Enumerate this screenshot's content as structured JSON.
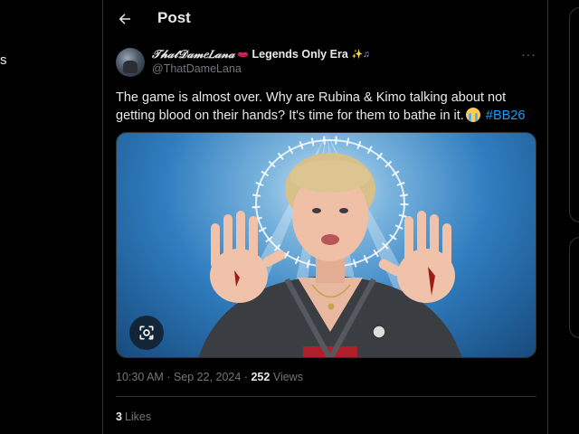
{
  "left_fragment": "s",
  "header": {
    "title": "Post",
    "back_icon": "arrow-left-icon"
  },
  "tweet": {
    "display_name": "𝒯𝒽𝒶𝓉𝒟𝒶𝓂𝑒𝐿𝒶𝓃𝒶",
    "name_suffix": "Legends Only Era",
    "name_emoji_tail": "✨♫",
    "handle": "@ThatDameLana",
    "text_main": "The game is almost over. Why are Rubina & Kimo talking about not getting blood on their hands? It's time for them to bathe in it.",
    "hashtag": "#BB26",
    "time": "10:30 AM",
    "separator": "·",
    "date": "Sep 22, 2024",
    "views_count": "252",
    "views_label": "Views",
    "likes_count": "3",
    "likes_label": "Likes",
    "more_label": "···"
  },
  "colors": {
    "background": "#000000",
    "text_primary": "#e7e9ea",
    "text_secondary": "#71767b",
    "accent_link": "#1d9bf0",
    "border": "#2f3336"
  }
}
